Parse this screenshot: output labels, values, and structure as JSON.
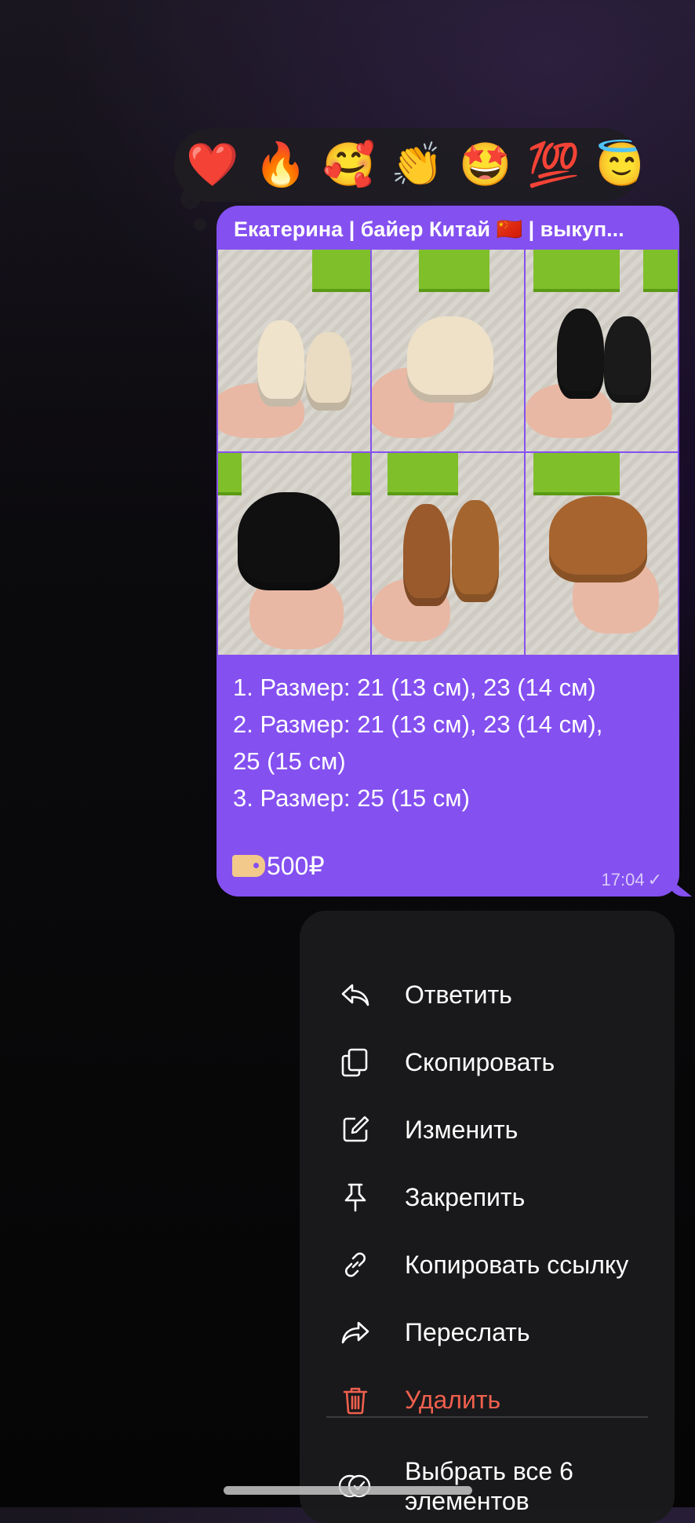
{
  "reactions": [
    "❤️",
    "🔥",
    "🥰",
    "👏",
    "🤩",
    "💯",
    "😇"
  ],
  "message": {
    "sender": "Екатерина | байер Китай 🇨🇳 | выкуп...",
    "caption_lines": [
      "1. Размер: 21 (13 см), 23 (14 см)",
      "2. Размер: 21 (13 см), 23 (14 см),\n25 (15 см)",
      "3. Размер: 25 (15 см)"
    ],
    "price": "500₽",
    "time": "17:04",
    "status_icon": "single-check-icon"
  },
  "menu": {
    "reply": "Ответить",
    "copy": "Скопировать",
    "edit": "Изменить",
    "pin": "Закрепить",
    "copy_link": "Копировать ссылку",
    "forward": "Переслать",
    "delete": "Удалить",
    "select_all": "Выбрать все 6 элементов"
  },
  "colors": {
    "bubble": "#8450f0",
    "danger": "#f0604e",
    "menu_bg": "#1a1a1c"
  }
}
